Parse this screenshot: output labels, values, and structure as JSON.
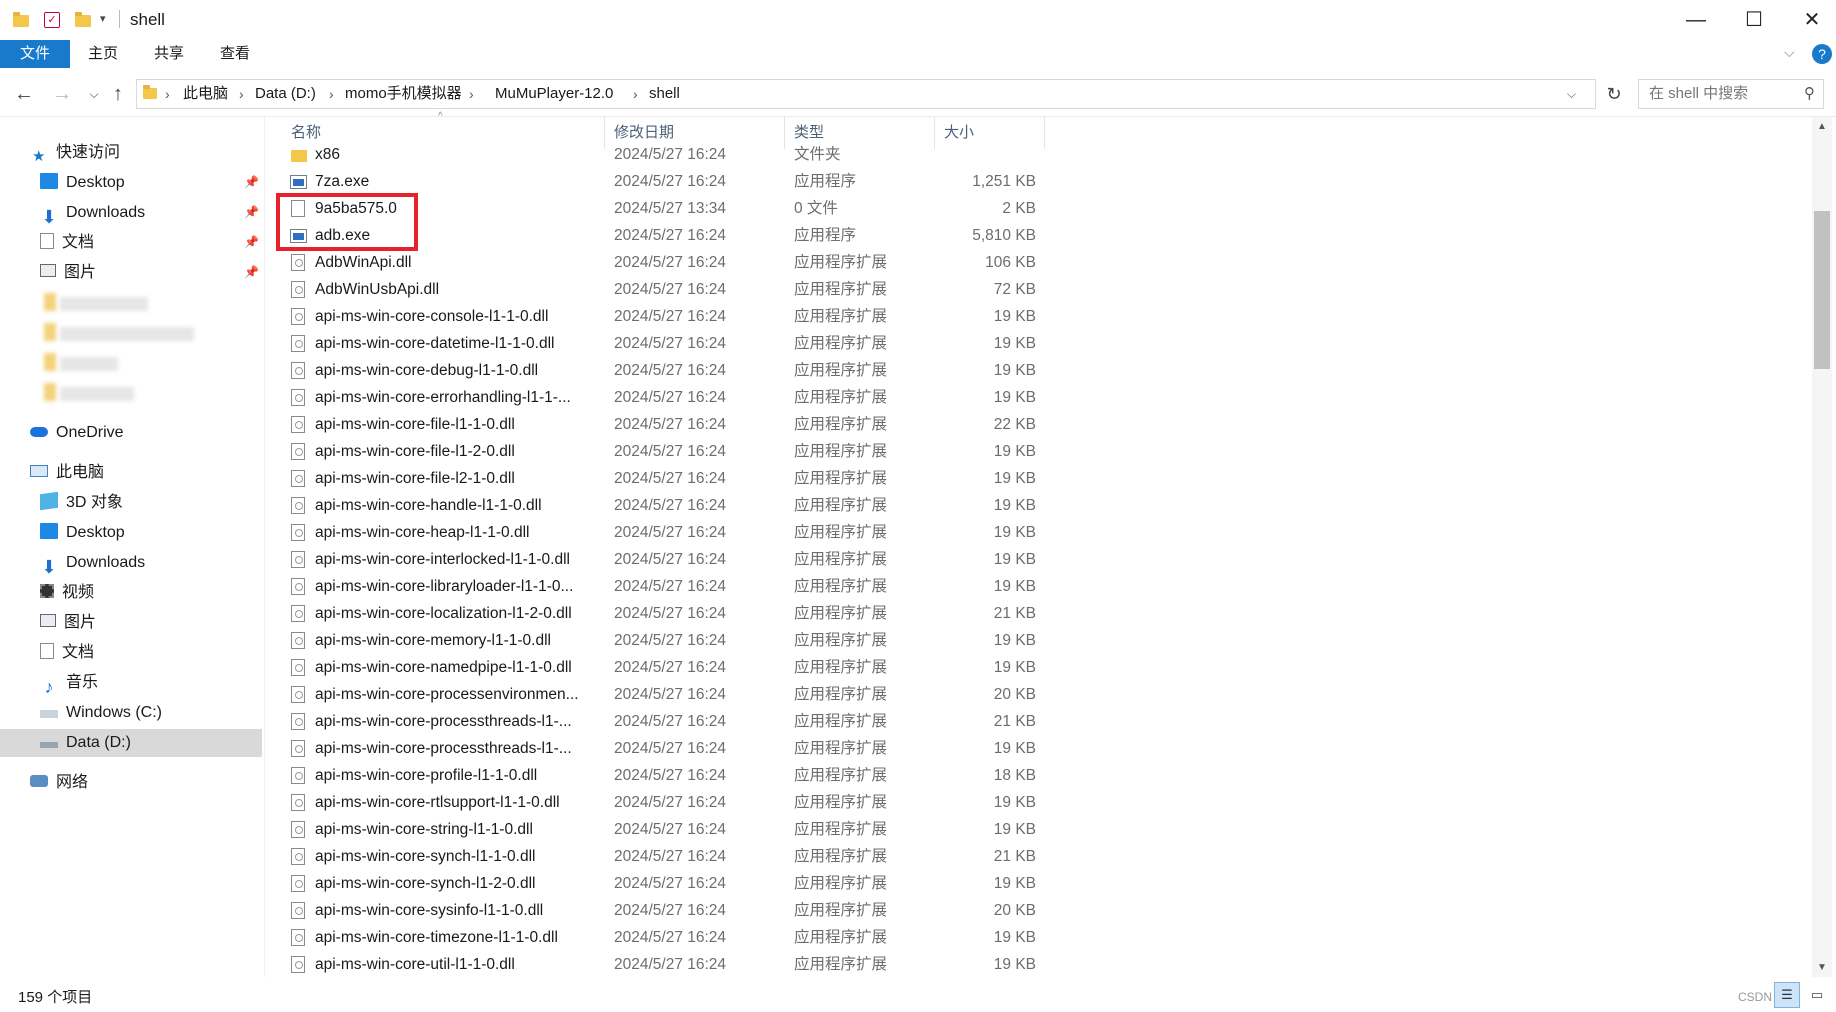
{
  "window": {
    "title": "shell",
    "controls": {
      "minimize": "—",
      "maximize": "☐",
      "close": "✕"
    }
  },
  "ribbon": {
    "tabs": [
      "文件",
      "主页",
      "共享",
      "查看"
    ],
    "help": "?"
  },
  "address": {
    "crumbs": [
      "此电脑",
      "Data (D:)",
      "momo手机模拟器",
      "MuMuPlayer-12.0",
      "shell"
    ],
    "search_placeholder": "在 shell 中搜索"
  },
  "sidebar": {
    "quick_access": "快速访问",
    "quick_items": [
      "Desktop",
      "Downloads",
      "文档",
      "图片"
    ],
    "onedrive": "OneDrive",
    "this_pc": "此电脑",
    "pc_items": [
      "3D 对象",
      "Desktop",
      "Downloads",
      "视频",
      "图片",
      "文档",
      "音乐",
      "Windows (C:)",
      "Data (D:)"
    ],
    "network": "网络",
    "selected": "Data (D:)"
  },
  "columns": {
    "name": "名称",
    "date": "修改日期",
    "type": "类型",
    "size": "大小"
  },
  "files": [
    {
      "name": "x86",
      "date": "2024/5/27 16:24",
      "type": "文件夹",
      "size": "",
      "icon": "folder"
    },
    {
      "name": "7za.exe",
      "date": "2024/5/27 16:24",
      "type": "应用程序",
      "size": "1,251 KB",
      "icon": "exe"
    },
    {
      "name": "9a5ba575.0",
      "date": "2024/5/27 13:34",
      "type": "0 文件",
      "size": "2 KB",
      "icon": "file"
    },
    {
      "name": "adb.exe",
      "date": "2024/5/27 16:24",
      "type": "应用程序",
      "size": "5,810 KB",
      "icon": "exe"
    },
    {
      "name": "AdbWinApi.dll",
      "date": "2024/5/27 16:24",
      "type": "应用程序扩展",
      "size": "106 KB",
      "icon": "dll"
    },
    {
      "name": "AdbWinUsbApi.dll",
      "date": "2024/5/27 16:24",
      "type": "应用程序扩展",
      "size": "72 KB",
      "icon": "dll"
    },
    {
      "name": "api-ms-win-core-console-l1-1-0.dll",
      "date": "2024/5/27 16:24",
      "type": "应用程序扩展",
      "size": "19 KB",
      "icon": "dll"
    },
    {
      "name": "api-ms-win-core-datetime-l1-1-0.dll",
      "date": "2024/5/27 16:24",
      "type": "应用程序扩展",
      "size": "19 KB",
      "icon": "dll"
    },
    {
      "name": "api-ms-win-core-debug-l1-1-0.dll",
      "date": "2024/5/27 16:24",
      "type": "应用程序扩展",
      "size": "19 KB",
      "icon": "dll"
    },
    {
      "name": "api-ms-win-core-errorhandling-l1-1-...",
      "date": "2024/5/27 16:24",
      "type": "应用程序扩展",
      "size": "19 KB",
      "icon": "dll"
    },
    {
      "name": "api-ms-win-core-file-l1-1-0.dll",
      "date": "2024/5/27 16:24",
      "type": "应用程序扩展",
      "size": "22 KB",
      "icon": "dll"
    },
    {
      "name": "api-ms-win-core-file-l1-2-0.dll",
      "date": "2024/5/27 16:24",
      "type": "应用程序扩展",
      "size": "19 KB",
      "icon": "dll"
    },
    {
      "name": "api-ms-win-core-file-l2-1-0.dll",
      "date": "2024/5/27 16:24",
      "type": "应用程序扩展",
      "size": "19 KB",
      "icon": "dll"
    },
    {
      "name": "api-ms-win-core-handle-l1-1-0.dll",
      "date": "2024/5/27 16:24",
      "type": "应用程序扩展",
      "size": "19 KB",
      "icon": "dll"
    },
    {
      "name": "api-ms-win-core-heap-l1-1-0.dll",
      "date": "2024/5/27 16:24",
      "type": "应用程序扩展",
      "size": "19 KB",
      "icon": "dll"
    },
    {
      "name": "api-ms-win-core-interlocked-l1-1-0.dll",
      "date": "2024/5/27 16:24",
      "type": "应用程序扩展",
      "size": "19 KB",
      "icon": "dll"
    },
    {
      "name": "api-ms-win-core-libraryloader-l1-1-0...",
      "date": "2024/5/27 16:24",
      "type": "应用程序扩展",
      "size": "19 KB",
      "icon": "dll"
    },
    {
      "name": "api-ms-win-core-localization-l1-2-0.dll",
      "date": "2024/5/27 16:24",
      "type": "应用程序扩展",
      "size": "21 KB",
      "icon": "dll"
    },
    {
      "name": "api-ms-win-core-memory-l1-1-0.dll",
      "date": "2024/5/27 16:24",
      "type": "应用程序扩展",
      "size": "19 KB",
      "icon": "dll"
    },
    {
      "name": "api-ms-win-core-namedpipe-l1-1-0.dll",
      "date": "2024/5/27 16:24",
      "type": "应用程序扩展",
      "size": "19 KB",
      "icon": "dll"
    },
    {
      "name": "api-ms-win-core-processenvironmen...",
      "date": "2024/5/27 16:24",
      "type": "应用程序扩展",
      "size": "20 KB",
      "icon": "dll"
    },
    {
      "name": "api-ms-win-core-processthreads-l1-...",
      "date": "2024/5/27 16:24",
      "type": "应用程序扩展",
      "size": "21 KB",
      "icon": "dll"
    },
    {
      "name": "api-ms-win-core-processthreads-l1-...",
      "date": "2024/5/27 16:24",
      "type": "应用程序扩展",
      "size": "19 KB",
      "icon": "dll"
    },
    {
      "name": "api-ms-win-core-profile-l1-1-0.dll",
      "date": "2024/5/27 16:24",
      "type": "应用程序扩展",
      "size": "18 KB",
      "icon": "dll"
    },
    {
      "name": "api-ms-win-core-rtlsupport-l1-1-0.dll",
      "date": "2024/5/27 16:24",
      "type": "应用程序扩展",
      "size": "19 KB",
      "icon": "dll"
    },
    {
      "name": "api-ms-win-core-string-l1-1-0.dll",
      "date": "2024/5/27 16:24",
      "type": "应用程序扩展",
      "size": "19 KB",
      "icon": "dll"
    },
    {
      "name": "api-ms-win-core-synch-l1-1-0.dll",
      "date": "2024/5/27 16:24",
      "type": "应用程序扩展",
      "size": "21 KB",
      "icon": "dll"
    },
    {
      "name": "api-ms-win-core-synch-l1-2-0.dll",
      "date": "2024/5/27 16:24",
      "type": "应用程序扩展",
      "size": "19 KB",
      "icon": "dll"
    },
    {
      "name": "api-ms-win-core-sysinfo-l1-1-0.dll",
      "date": "2024/5/27 16:24",
      "type": "应用程序扩展",
      "size": "20 KB",
      "icon": "dll"
    },
    {
      "name": "api-ms-win-core-timezone-l1-1-0.dll",
      "date": "2024/5/27 16:24",
      "type": "应用程序扩展",
      "size": "19 KB",
      "icon": "dll"
    },
    {
      "name": "api-ms-win-core-util-l1-1-0.dll",
      "date": "2024/5/27 16:24",
      "type": "应用程序扩展",
      "size": "19 KB",
      "icon": "dll"
    }
  ],
  "status": {
    "item_count": "159 个项目",
    "watermark": "CSDN @"
  },
  "colors": {
    "accent": "#1979ca",
    "highlight": "#e8222a",
    "selected_nav": "#d9d9d9"
  }
}
